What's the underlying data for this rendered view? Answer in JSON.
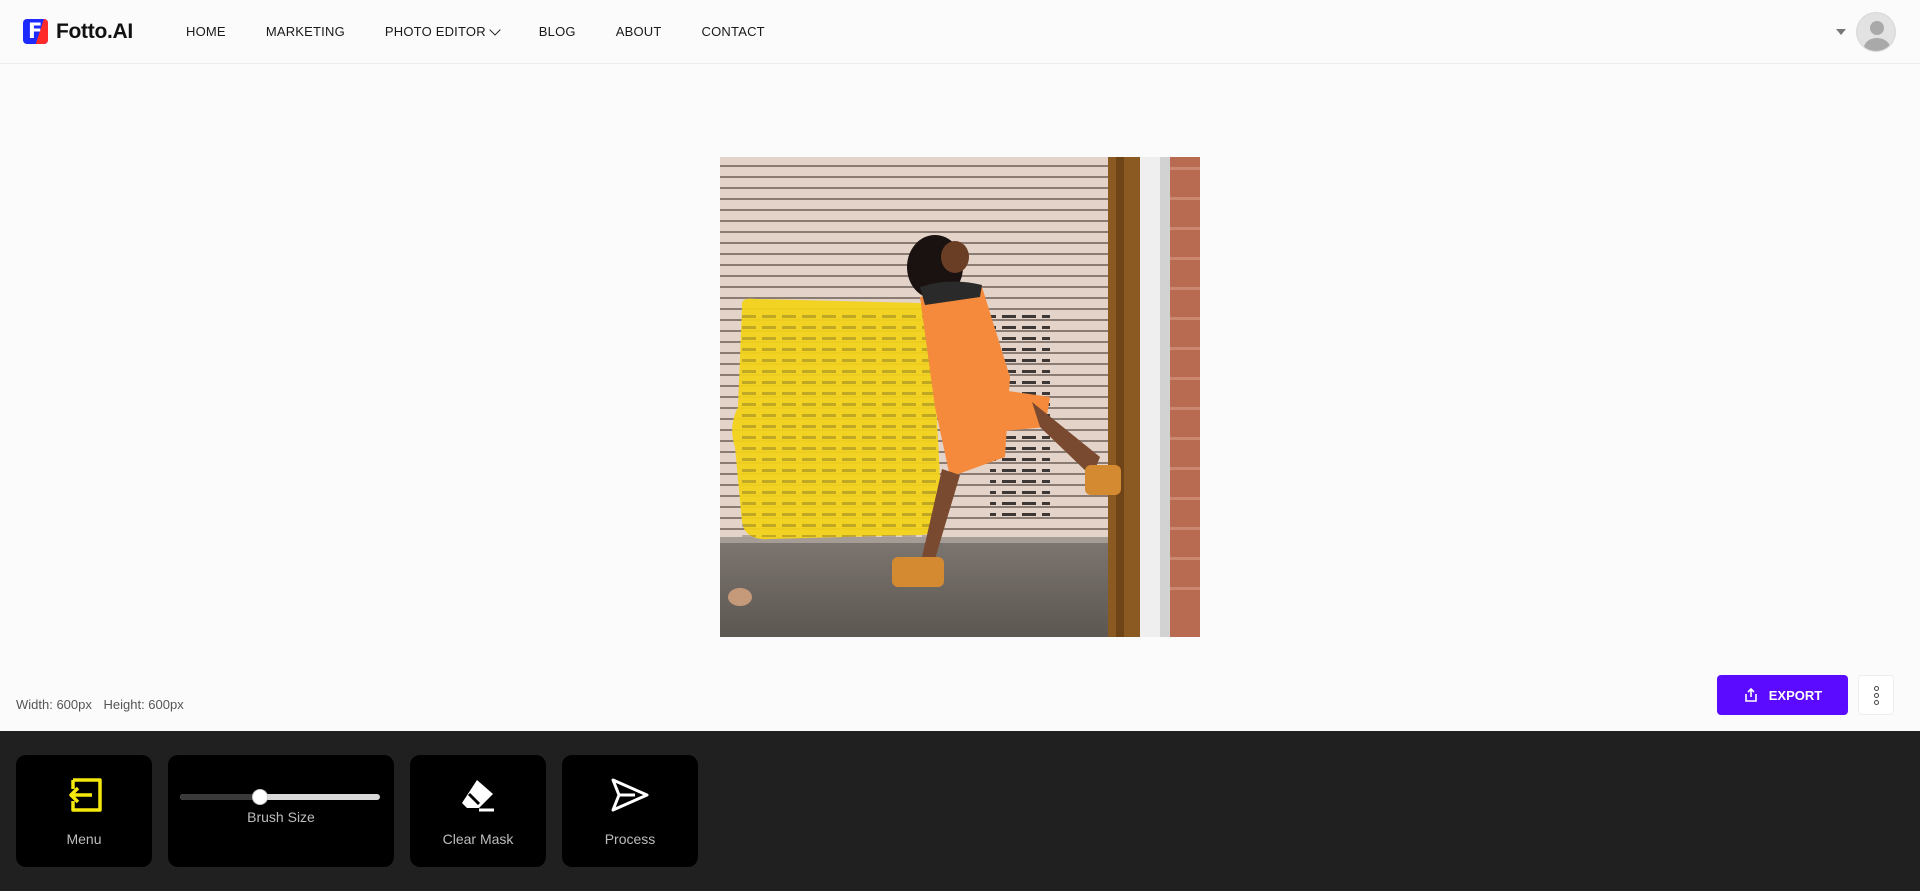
{
  "brand": {
    "badge_letter": "F",
    "name": "Fotto.AI"
  },
  "nav": {
    "home": "HOME",
    "marketing": "MARKETING",
    "photo_editor": "PHOTO EDITOR",
    "blog": "BLOG",
    "about": "ABOUT",
    "contact": "CONTACT"
  },
  "image_info": {
    "width": "Width: 600px",
    "height": "Height: 600px"
  },
  "actions": {
    "export": "EXPORT"
  },
  "toolbar": {
    "menu": "Menu",
    "brush_size": "Brush Size",
    "brush_size_level": 0.4,
    "clear_mask": "Clear Mask",
    "process": "Process"
  },
  "colors": {
    "accent": "#5b0bff",
    "mask": "#f2d21a",
    "toolbar_bg": "#202020",
    "menu_icon": "#f5e90b"
  },
  "icons": [
    "fotto-logo-icon",
    "chevron-down-icon",
    "caret-down-icon",
    "avatar-icon",
    "export-icon",
    "more-vertical-icon",
    "exit-icon",
    "eraser-icon",
    "send-icon"
  ]
}
